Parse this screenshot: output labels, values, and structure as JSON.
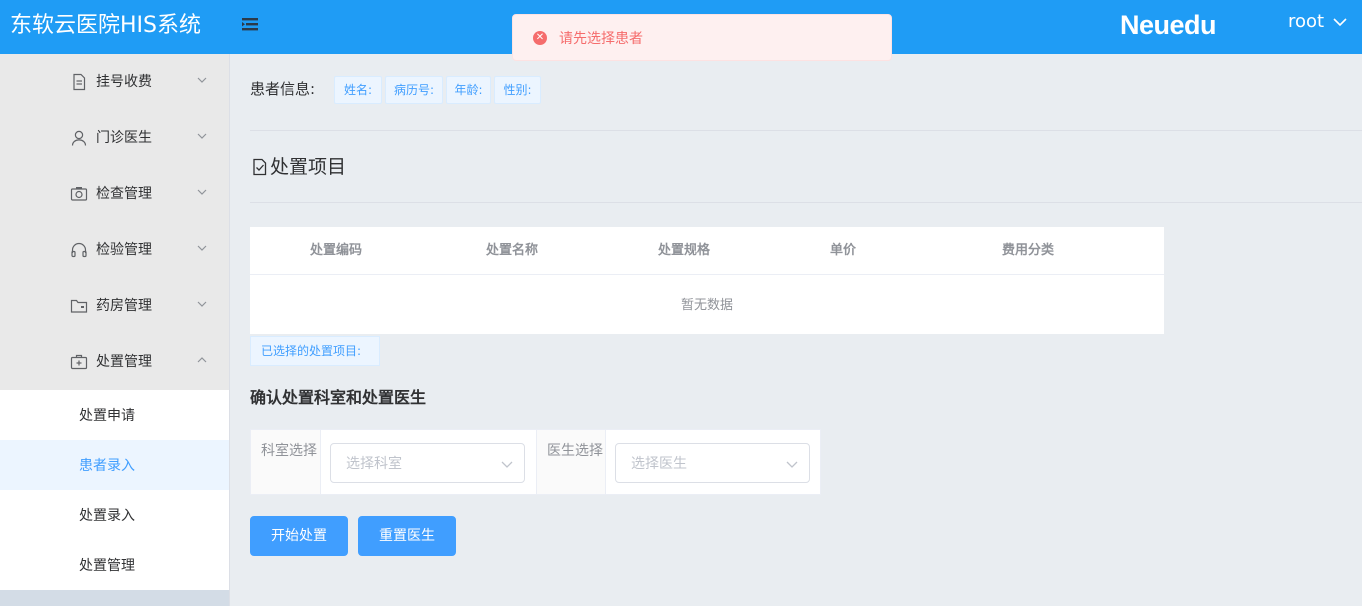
{
  "header": {
    "app_title": "东软云医院HIS系统",
    "brand": "Neuedu",
    "user": "root"
  },
  "toast": {
    "message": "请先选择患者",
    "type": "error"
  },
  "sidebar": {
    "items": [
      {
        "label": "挂号收费",
        "icon": "document-icon"
      },
      {
        "label": "门诊医生",
        "icon": "user-icon"
      },
      {
        "label": "检查管理",
        "icon": "camera-icon"
      },
      {
        "label": "检验管理",
        "icon": "headset-icon"
      },
      {
        "label": "药房管理",
        "icon": "folder-icon"
      },
      {
        "label": "处置管理",
        "icon": "medical-box-icon",
        "expanded": true
      }
    ],
    "sub_items": [
      {
        "label": "处置申请"
      },
      {
        "label": "患者录入",
        "active": true
      },
      {
        "label": "处置录入"
      },
      {
        "label": "处置管理"
      }
    ]
  },
  "patient_info": {
    "label": "患者信息:",
    "tags": [
      "姓名:",
      "病历号:",
      "年龄:",
      "性别:"
    ]
  },
  "section": {
    "title": "处置项目"
  },
  "table": {
    "columns": [
      "处置编码",
      "处置名称",
      "处置规格",
      "单价",
      "费用分类"
    ],
    "empty_text": "暂无数据"
  },
  "selected_label": "已选择的处置项目:",
  "confirm": {
    "title": "确认处置科室和处置医生",
    "dept_label": "科室选择",
    "dept_placeholder": "选择科室",
    "doctor_label": "医生选择",
    "doctor_placeholder": "选择医生"
  },
  "buttons": {
    "start": "开始处置",
    "reset": "重置医生"
  },
  "colors": {
    "header_bg": "#1f9cf5",
    "primary": "#409eff",
    "error": "#f56c6c",
    "sidebar_bg": "#e9e9e9",
    "main_bg": "#e9edf1"
  }
}
